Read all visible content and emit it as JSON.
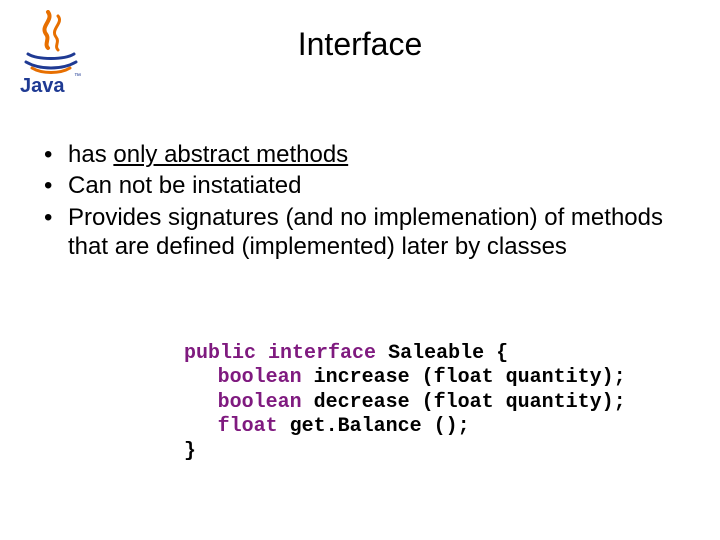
{
  "logo": {
    "brand": "Java",
    "accent_color": "#e76f00",
    "text_color": "#1f3a93"
  },
  "title": "Interface",
  "bullets": [
    {
      "prefix": "has ",
      "underlined": "only abstract methods",
      "suffix": ""
    },
    {
      "prefix": "Can not be instatiated",
      "underlined": "",
      "suffix": ""
    },
    {
      "prefix": "Provides signatures (and no implemenation) of methods that are defined (implemented) later by classes",
      "underlined": "",
      "suffix": ""
    }
  ],
  "code": {
    "kw_public": "public",
    "kw_interface": "interface",
    "class_name": "Saleable",
    "brace_open": "{",
    "line1_type": "boolean",
    "line1_rest": "increase (float quantity);",
    "line2_type": "boolean",
    "line2_rest": "decrease (float quantity);",
    "line3_type": "float",
    "line3_rest": "get.Balance ();",
    "brace_close": "}"
  }
}
